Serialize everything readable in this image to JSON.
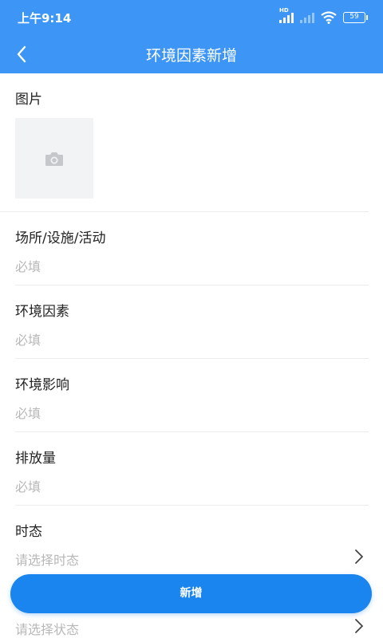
{
  "status_bar": {
    "time": "上午9:14",
    "signal_label": "HD",
    "battery": "59"
  },
  "header": {
    "title": "环境因素新增"
  },
  "form": {
    "picture_label": "图片",
    "fields": [
      {
        "label": "场所/设施/活动",
        "placeholder": "必填"
      },
      {
        "label": "环境因素",
        "placeholder": "必填"
      },
      {
        "label": "环境影响",
        "placeholder": "必填"
      },
      {
        "label": "排放量",
        "placeholder": "必填"
      },
      {
        "label": "时态",
        "placeholder": "请选择时态"
      }
    ],
    "partial_field_placeholder": "请选择状态"
  },
  "actions": {
    "submit_label": "新增"
  },
  "colors": {
    "primary": "#3d96f5",
    "button": "#1a84ef",
    "placeholder": "#b8b8b8"
  },
  "icons": [
    "back-arrow-icon",
    "camera-icon",
    "chevron-right-icon",
    "wifi-icon",
    "signal-icon",
    "battery-icon"
  ]
}
